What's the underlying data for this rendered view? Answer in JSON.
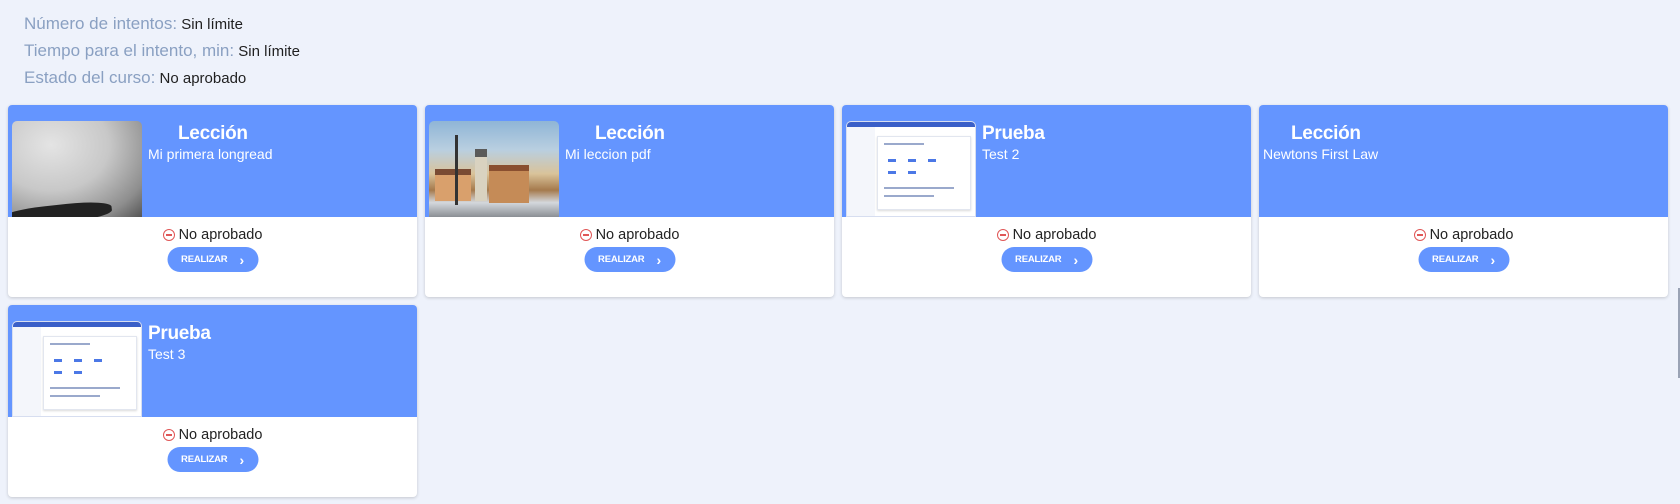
{
  "info": {
    "rows": [
      {
        "label": "Número de intentos:",
        "value": " Sin límite"
      },
      {
        "label": "Tiempo para el intento, min:",
        "value": " Sin límite"
      },
      {
        "label": "Estado del curso:",
        "value": " No aprobado"
      }
    ]
  },
  "cards": [
    {
      "type": "Lección",
      "name": "Mi primera longread",
      "status": "No aprobado",
      "button": "REALIZAR",
      "thumbnail": "grey-photo"
    },
    {
      "type": "Lección",
      "name": "Mi leccion pdf",
      "status": "No aprobado",
      "button": "REALIZAR",
      "thumbnail": "town-painting"
    },
    {
      "type": "Prueba",
      "name": "Test 2",
      "status": "No aprobado",
      "button": "REALIZAR",
      "thumbnail": "app-screenshot"
    },
    {
      "type": "Lección",
      "name": "Newtons First Law",
      "status": "No aprobado",
      "button": "REALIZAR",
      "thumbnail": "none"
    },
    {
      "type": "Prueba",
      "name": "Test 3",
      "status": "No aprobado",
      "button": "REALIZAR",
      "thumbnail": "app-screenshot"
    }
  ],
  "icons": {
    "status": "no-entry-icon",
    "button": "chevron-right-icon"
  },
  "colors": {
    "accent": "#6495ff",
    "background": "#eef2fb",
    "label": "#8aa0c2",
    "status_icon": "#e05757"
  }
}
